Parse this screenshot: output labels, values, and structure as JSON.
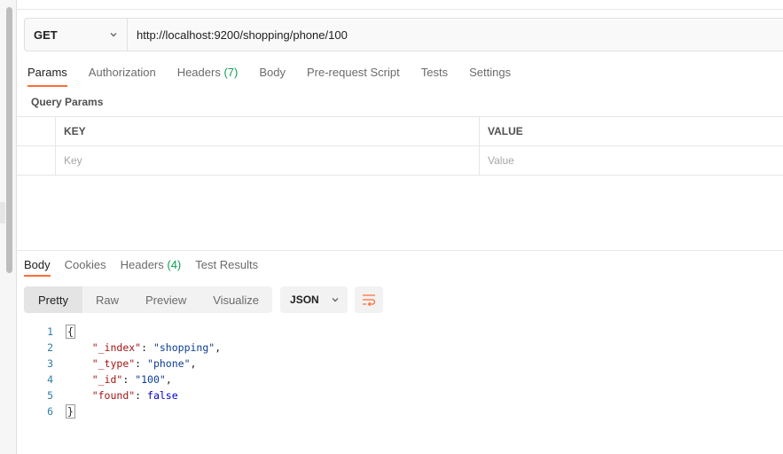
{
  "request": {
    "method": "GET",
    "url": "http://localhost:9200/shopping/phone/100"
  },
  "request_tabs": [
    {
      "label": "Params",
      "count": ""
    },
    {
      "label": "Authorization",
      "count": ""
    },
    {
      "label": "Headers",
      "count": "(7)"
    },
    {
      "label": "Body",
      "count": ""
    },
    {
      "label": "Pre-request Script",
      "count": ""
    },
    {
      "label": "Tests",
      "count": ""
    },
    {
      "label": "Settings",
      "count": ""
    }
  ],
  "query_params": {
    "title": "Query Params",
    "key_header": "KEY",
    "value_header": "VALUE",
    "key_placeholder": "Key",
    "value_placeholder": "Value"
  },
  "response_tabs": [
    {
      "label": "Body",
      "count": ""
    },
    {
      "label": "Cookies",
      "count": ""
    },
    {
      "label": "Headers",
      "count": "(4)"
    },
    {
      "label": "Test Results",
      "count": ""
    }
  ],
  "view_modes": [
    "Pretty",
    "Raw",
    "Preview",
    "Visualize"
  ],
  "format": "JSON",
  "response_body": [
    {
      "n": "1",
      "text": "{"
    },
    {
      "n": "2",
      "key": "\"_index\"",
      "value": "\"shopping\"",
      "trail": ","
    },
    {
      "n": "3",
      "key": "\"_type\"",
      "value": "\"phone\"",
      "trail": ","
    },
    {
      "n": "4",
      "key": "\"_id\"",
      "value": "\"100\"",
      "trail": ","
    },
    {
      "n": "5",
      "key": "\"found\"",
      "value": "false",
      "trail": ""
    },
    {
      "n": "6",
      "text": "}"
    }
  ],
  "colors": {
    "accent": "#ff6c37",
    "count": "#0f9d58"
  }
}
